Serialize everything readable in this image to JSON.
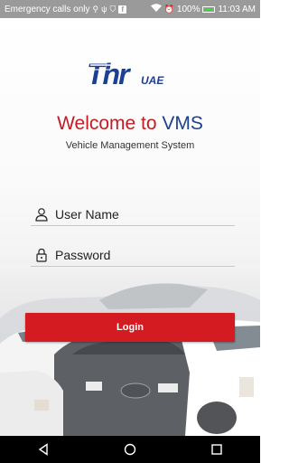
{
  "status_bar": {
    "carrier_text": "Emergency calls only",
    "left_icons": [
      "usb-icon",
      "usb-icon",
      "shield-icon",
      "facebook-icon"
    ],
    "right_icons": [
      "wifi-icon",
      "alarm-icon"
    ],
    "battery_percent": "100%",
    "time": "11:03 AM",
    "facebook_glyph": "f"
  },
  "header": {
    "logo_name": "Thr UAE logo",
    "logo_main": "Thr",
    "logo_sub": "UAE",
    "welcome_prefix": "Welcome to ",
    "welcome_highlight": "VMS",
    "subtitle": "Vehicle Management System"
  },
  "form": {
    "username_placeholder": "User Name",
    "password_placeholder": "Password",
    "login_label": "Login"
  },
  "colors": {
    "brand_red": "#d41b21",
    "brand_blue": "#1d3f91",
    "status_bar": "#9a9a9a"
  }
}
